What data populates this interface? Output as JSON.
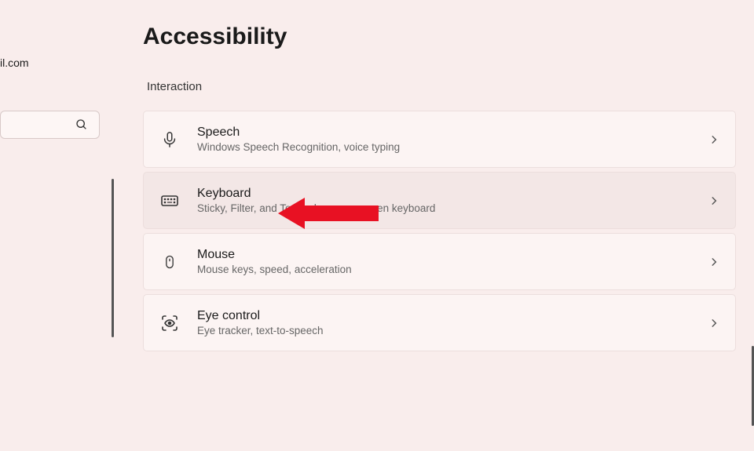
{
  "sidebar": {
    "email_fragment": "il.com"
  },
  "page": {
    "title": "Accessibility",
    "section": "Interaction"
  },
  "settings": [
    {
      "icon": "speech-icon",
      "title": "Speech",
      "description": "Windows Speech Recognition, voice typing",
      "highlighted": false
    },
    {
      "icon": "keyboard-icon",
      "title": "Keyboard",
      "description": "Sticky, Filter, and Toggle keys, on-screen keyboard",
      "highlighted": true
    },
    {
      "icon": "mouse-icon",
      "title": "Mouse",
      "description": "Mouse keys, speed, acceleration",
      "highlighted": false
    },
    {
      "icon": "eye-control-icon",
      "title": "Eye control",
      "description": "Eye tracker, text-to-speech",
      "highlighted": false
    }
  ],
  "annotation": {
    "arrow_color": "#e81123"
  }
}
